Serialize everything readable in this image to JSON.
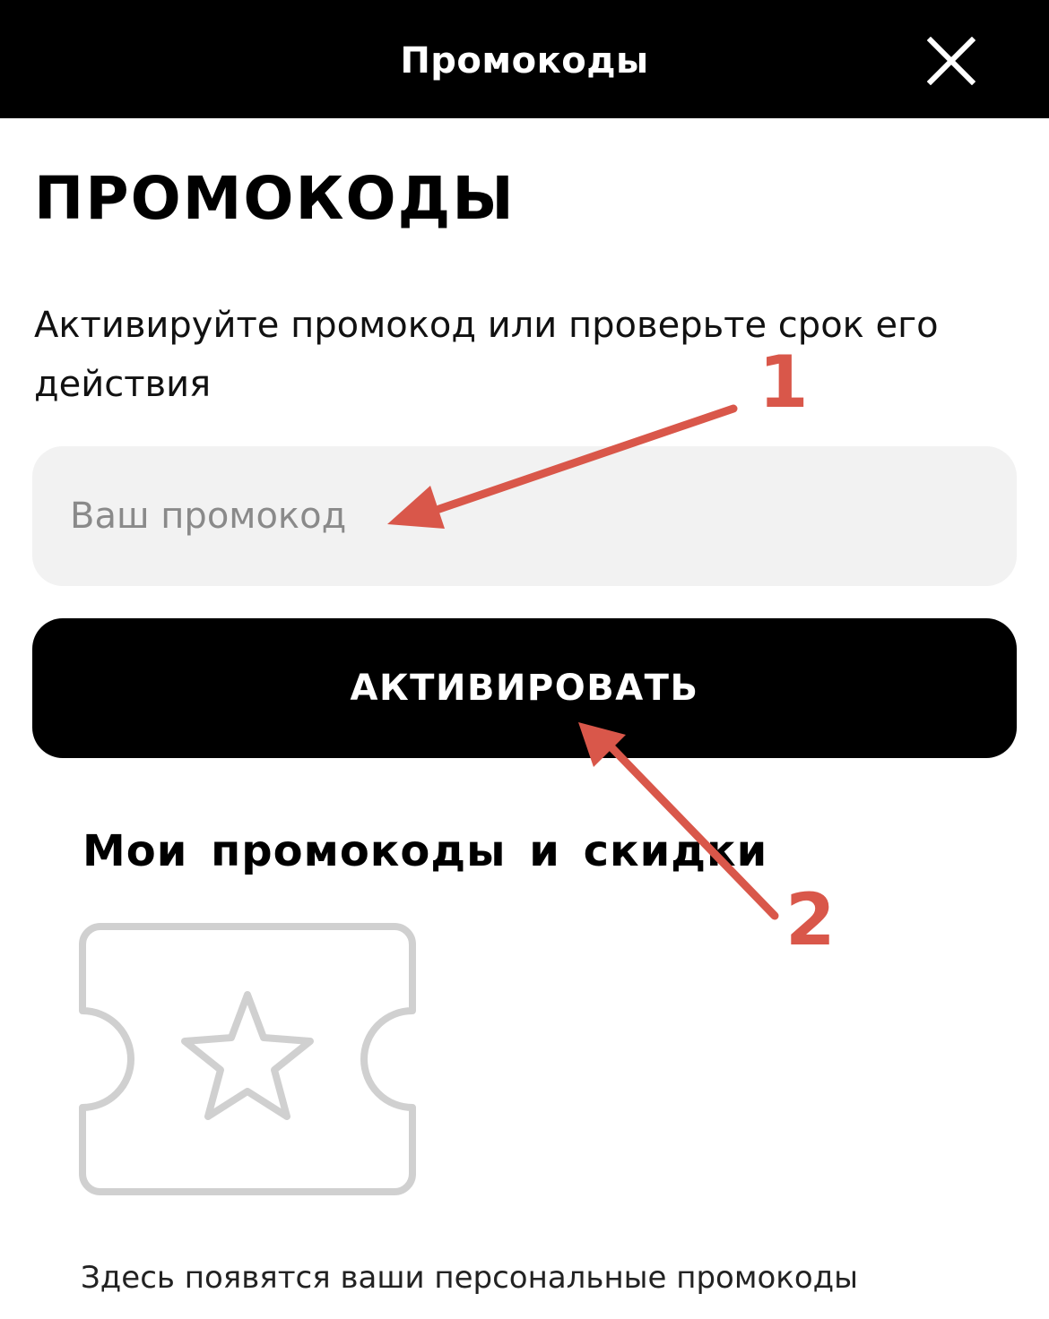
{
  "header": {
    "title": "Промокоды",
    "close_icon": "close-icon"
  },
  "main": {
    "heading": "ПРОМОКОДЫ",
    "description": "Активируйте промокод или проверьте срок его действия",
    "promo_input": {
      "value": "",
      "placeholder": "Ваш промокод"
    },
    "activate_label": "АКТИВИРОВАТЬ",
    "section_title": "Мои промокоды и скидки",
    "empty_icon": "ticket-star-icon",
    "empty_text": "Здесь появятся ваши персональные промокоды"
  },
  "annotations": {
    "marker_1": "1",
    "marker_2": "2",
    "color": "#d9574a"
  },
  "colors": {
    "topbar_bg": "#000000",
    "input_bg": "#f2f2f2",
    "button_bg": "#000000",
    "icon_gray": "#d0d0d0"
  }
}
